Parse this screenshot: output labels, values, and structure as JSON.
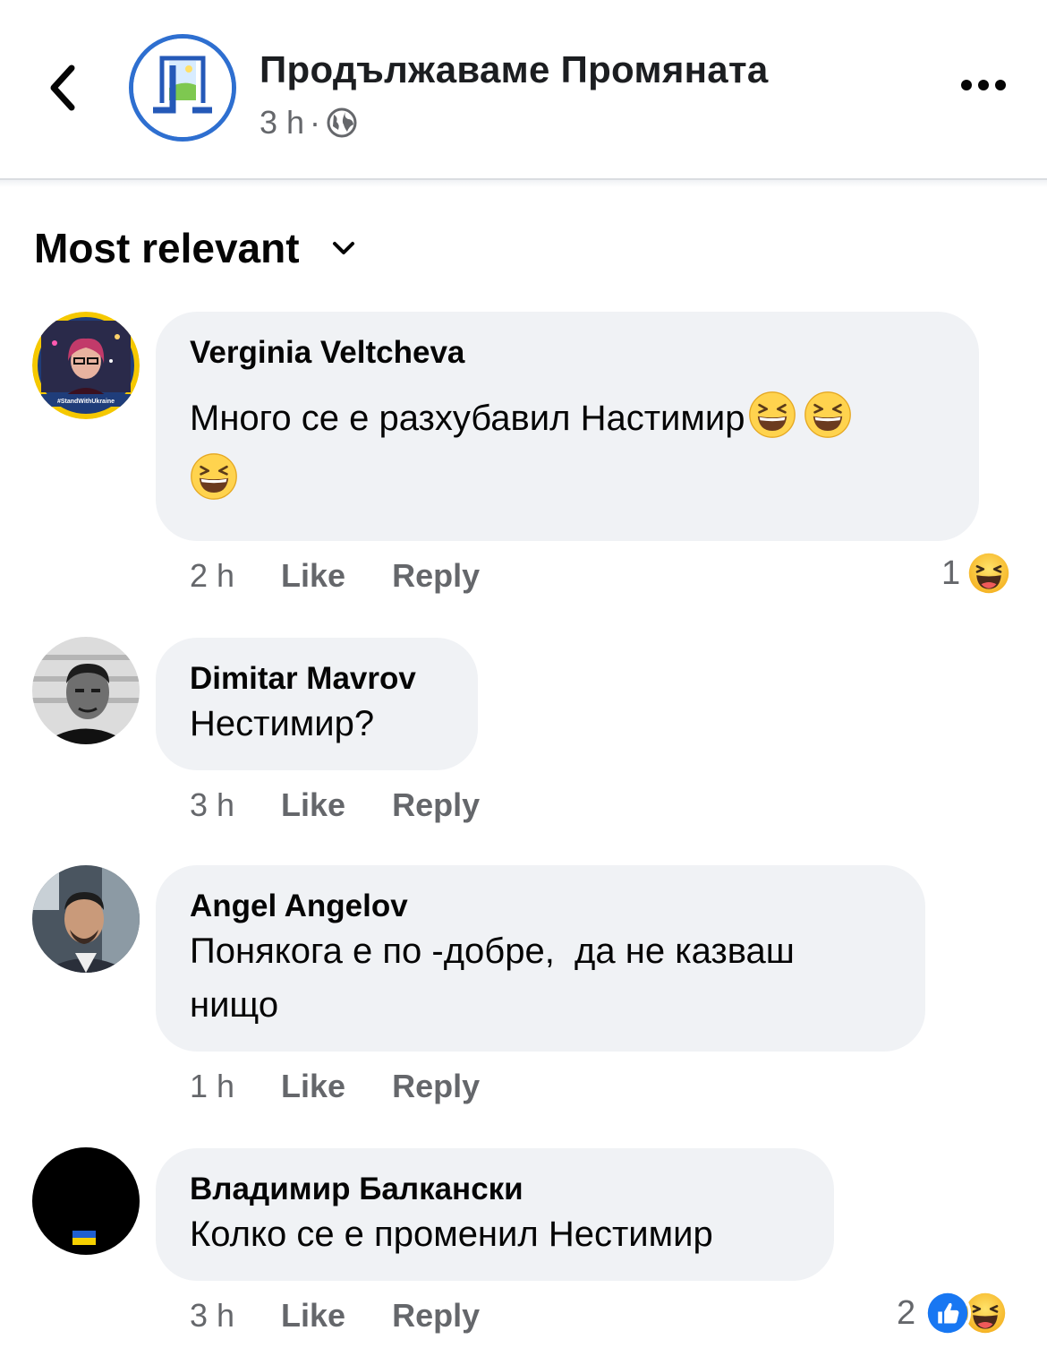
{
  "header": {
    "page_name": "Продължаваме Промяната",
    "time": "3 h",
    "separator": "·",
    "privacy_icon": "globe-icon",
    "back_icon": "chevron-left-icon",
    "more_icon": "more-dots-icon"
  },
  "sort": {
    "label": "Most relevant",
    "icon": "chevron-down-icon"
  },
  "comments": [
    {
      "author": "Verginia Veltcheva",
      "text": "Много се е разхубавил Настимир",
      "avatar_badge": "#StandWithUkraine",
      "time": "2 h",
      "like": "Like",
      "reply": "Reply",
      "reaction_count": "1",
      "reactions": [
        "haha-icon"
      ]
    },
    {
      "author": "Dimitar Mavrov",
      "text": "Нестимир?",
      "time": "3 h",
      "like": "Like",
      "reply": "Reply"
    },
    {
      "author": "Angel Angelov",
      "text_line1": "Понякога е по -добре,  да не казваш",
      "text_line2": "нищо",
      "time": "1 h",
      "like": "Like",
      "reply": "Reply"
    },
    {
      "author": "Владимир Балкански",
      "text": "Колко се е променил Нестимир",
      "time": "3 h",
      "like": "Like",
      "reply": "Reply",
      "reaction_count": "2",
      "reactions": [
        "like-icon",
        "haha-icon"
      ]
    }
  ],
  "colors": {
    "bubble": "#f0f2f5",
    "secondary_text": "#65676b",
    "brand_blue": "#2e6fd0",
    "like_blue": "#1877f2",
    "haha_yellow": "#f7b928"
  }
}
